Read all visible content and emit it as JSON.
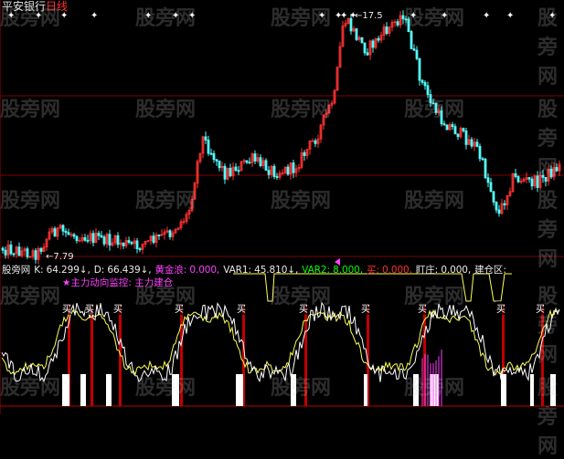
{
  "chart_data": {
    "type": "candlestick",
    "title": "平安银行",
    "period": "日线",
    "price_high_label": "17.5",
    "price_low_label": "7.79",
    "indicator": {
      "name": "股旁网",
      "fields": [
        {
          "label": "K",
          "value": "64.299",
          "arrow": "↓",
          "color": "#e8e8e8"
        },
        {
          "label": "D",
          "value": "66.439",
          "arrow": "↓",
          "color": "#e8e8e8"
        },
        {
          "label": "黄金浪",
          "value": "0.000",
          "color": "#ff40ff"
        },
        {
          "label": "VAR1",
          "value": "45.810",
          "arrow": "↓",
          "color": "#e8e8e8"
        },
        {
          "label": "VAR2",
          "value": "8.000",
          "color": "#00ff00"
        },
        {
          "label": "买",
          "value": "0.000",
          "color": "#ff3030"
        },
        {
          "label": "盯庄",
          "value": "0.000",
          "color": "#e8e8e8"
        },
        {
          "label": "建仓区",
          "value": "",
          "color": "#e8e8e8"
        }
      ],
      "legend2": "★主力动向监控: 主力建仓",
      "buy_label": "买",
      "buy_positions": [
        0.12,
        0.16,
        0.21,
        0.32,
        0.43,
        0.54,
        0.65,
        0.75,
        0.89,
        0.96
      ]
    }
  },
  "watermark": "股旁网",
  "colors": {
    "up": "#ff3232",
    "down": "#54fcfc",
    "k_line": "#ffffff",
    "d_line": "#ffff54",
    "buy_bar": "#c00000",
    "gridline": "#800000",
    "magenta": "#ff40ff"
  }
}
